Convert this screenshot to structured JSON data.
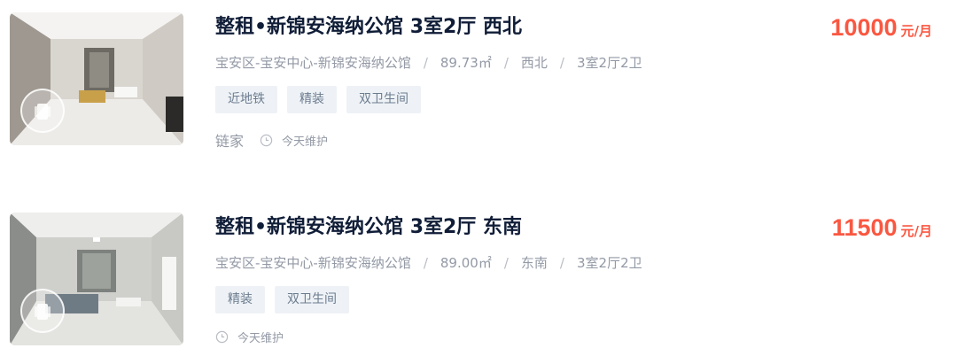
{
  "listings": [
    {
      "title": "整租•新锦安海纳公馆 3室2厅 西北",
      "location": "宝安区-宝安中心-新锦安海纳公馆",
      "area": "89.73㎡",
      "orientation": "西北",
      "layout": "3室2厅2卫",
      "tags": [
        "近地铁",
        "精装",
        "双卫生间"
      ],
      "brand": "链家",
      "maintenance": "今天维护",
      "price": "10000",
      "price_unit": "元/月",
      "thumbnail": "vr-tour-icon"
    },
    {
      "title": "整租•新锦安海纳公馆 3室2厅 东南",
      "location": "宝安区-宝安中心-新锦安海纳公馆",
      "area": "89.00㎡",
      "orientation": "东南",
      "layout": "3室2厅2卫",
      "tags": [
        "精装",
        "双卫生间"
      ],
      "brand": "",
      "maintenance": "今天维护",
      "price": "11500",
      "price_unit": "元/月",
      "thumbnail": "vr-tour-icon"
    }
  ],
  "separator": "/",
  "colors": {
    "price": "#fa5741",
    "title": "#101d37",
    "meta": "#9399a5",
    "tag_bg": "#eef2f6",
    "tag_text": "#6c7c8f"
  }
}
